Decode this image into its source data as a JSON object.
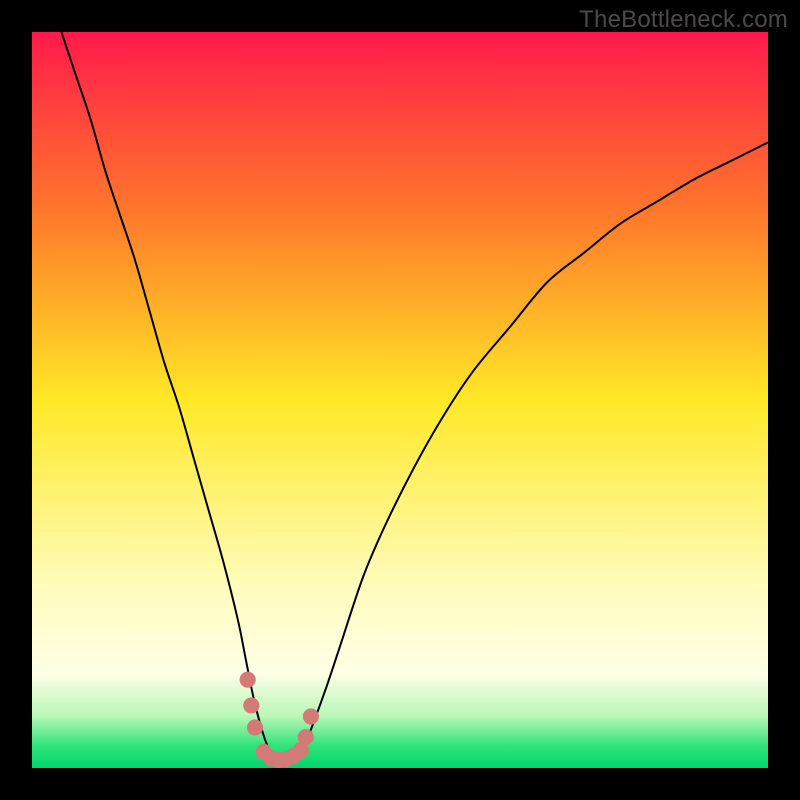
{
  "watermark": "TheBottleneck.com",
  "chart_data": {
    "type": "line",
    "title": "",
    "xlabel": "",
    "ylabel": "",
    "xlim": [
      0,
      100
    ],
    "ylim": [
      0,
      100
    ],
    "gradient_stops": [
      {
        "offset": 0.0,
        "color": "#ff1a4b"
      },
      {
        "offset": 0.25,
        "color": "#ff7a2a"
      },
      {
        "offset": 0.5,
        "color": "#ffe827"
      },
      {
        "offset": 0.75,
        "color": "#fffcbb"
      },
      {
        "offset": 0.87,
        "color": "#ffffe6"
      },
      {
        "offset": 0.93,
        "color": "#b7f7b7"
      },
      {
        "offset": 0.97,
        "color": "#2fe37a"
      },
      {
        "offset": 1.0,
        "color": "#00d66c"
      }
    ],
    "series": [
      {
        "name": "bottleneck-curve",
        "x": [
          4,
          6,
          8,
          10,
          12,
          14,
          16,
          18,
          20,
          22,
          24,
          26,
          28,
          29,
          30,
          31,
          32,
          33,
          34,
          35,
          36,
          37,
          38,
          40,
          42,
          45,
          48,
          52,
          56,
          60,
          65,
          70,
          75,
          80,
          85,
          90,
          95,
          100
        ],
        "y": [
          100,
          94,
          88,
          81,
          75,
          69,
          62,
          55,
          49,
          42,
          35,
          28,
          20,
          15,
          10,
          6,
          3,
          1.5,
          1,
          1,
          1.5,
          3,
          5.5,
          11,
          17,
          26,
          33,
          41,
          48,
          54,
          60,
          66,
          70,
          74,
          77,
          80,
          82.5,
          85
        ]
      }
    ],
    "markers": {
      "name": "highlight-points",
      "color": "#d37a77",
      "radius_frac": 0.011,
      "x": [
        29.3,
        29.8,
        30.3,
        31.5,
        32.5,
        33.5,
        34.5,
        35.5,
        36.5,
        37.2,
        37.9
      ],
      "y": [
        12.0,
        8.5,
        5.5,
        2.2,
        1.3,
        1.1,
        1.2,
        1.6,
        2.4,
        4.2,
        7.0
      ]
    }
  }
}
